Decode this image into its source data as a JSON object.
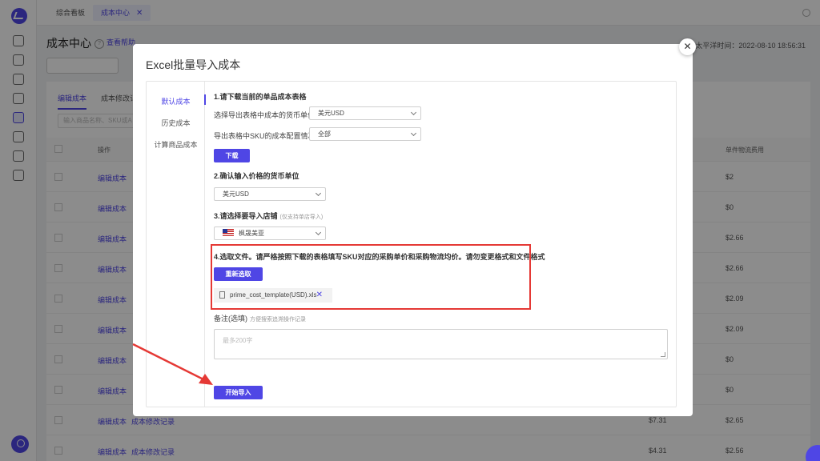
{
  "tabs": [
    {
      "label": "综合看板"
    },
    {
      "label": "成本中心"
    }
  ],
  "page": {
    "title": "成本中心",
    "help": "查看帮助",
    "timestamp": "太平洋时间：2022-08-10 18:56:31",
    "sub_tabs": [
      "编辑成本",
      "成本修改记"
    ],
    "search_placeholder": "输入商品名称、SKU或A",
    "headers": {
      "op": "操作",
      "fee": "单件物流费用"
    },
    "rows": [
      {
        "edit": "编辑成本",
        "log": "",
        "cost": "",
        "fee": "$2"
      },
      {
        "edit": "编辑成本",
        "log": "",
        "cost": "",
        "fee": "$0"
      },
      {
        "edit": "编辑成本",
        "log": "",
        "cost": "",
        "fee": "$2.66"
      },
      {
        "edit": "编辑成本",
        "log": "",
        "cost": "",
        "fee": "$2.66"
      },
      {
        "edit": "编辑成本",
        "log": "",
        "cost": "",
        "fee": "$2.09"
      },
      {
        "edit": "编辑成本",
        "log": "",
        "cost": "",
        "fee": "$2.09"
      },
      {
        "edit": "编辑成本",
        "log": "",
        "cost": "",
        "fee": "$0"
      },
      {
        "edit": "编辑成本",
        "log": "",
        "cost": "",
        "fee": "$0"
      },
      {
        "edit": "编辑成本",
        "log": "成本修改记录",
        "cost": "$7.31",
        "fee": "$2.65"
      },
      {
        "edit": "编辑成本",
        "log": "成本修改记录",
        "cost": "$4.31",
        "fee": "$2.56"
      }
    ]
  },
  "modal": {
    "title": "Excel批量导入成本",
    "close": "✕",
    "side_nav": [
      "默认成本",
      "历史成本",
      "计算商品成本"
    ],
    "step1": {
      "title": "1.请下载当前的单品成本表格",
      "currency_label": "选择导出表格中成本的货币单位",
      "currency_value": "美元USD",
      "sku_label": "导出表格中SKU的成本配置情况",
      "sku_value": "全部",
      "download": "下载"
    },
    "step2": {
      "title": "2.确认输入价格的货币单位",
      "currency_value": "美元USD"
    },
    "step3": {
      "title": "3.请选择要导入店铺",
      "hint": "(仅支持单店导入)",
      "store_value": "枫晟美亚"
    },
    "step4": {
      "title": "4.选取文件。请严格按照下载的表格填写SKU对应的采购单价和采购物流均价。请勿变更格式和文件格式",
      "reselect": "重新选取",
      "file_name": "prime_cost_template(USD).xls",
      "remove": "✕"
    },
    "remark": {
      "label": "备注(选填)",
      "hint": "方便搜索追溯操作记录",
      "placeholder": "最多200字"
    },
    "submit": "开始导入"
  },
  "colors": {
    "accent": "#4f46e5",
    "highlight": "#e53935",
    "arrow": "#e53935"
  }
}
